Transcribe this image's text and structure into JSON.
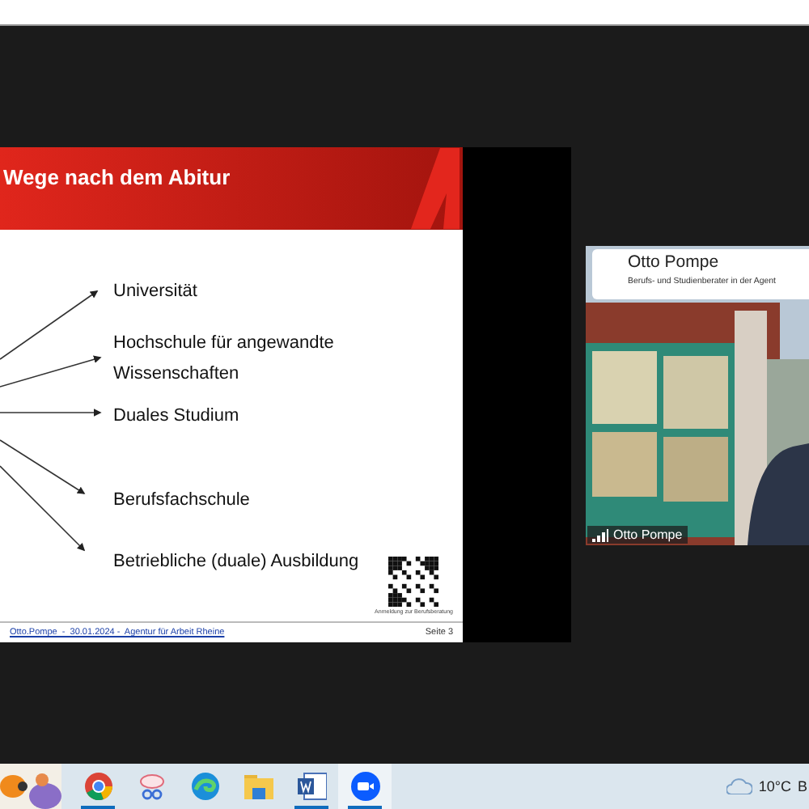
{
  "slide": {
    "title": "Wege nach dem Abitur",
    "options": [
      "Universität",
      "Hochschule für angewandte Wissenschaften",
      "Duales Studium",
      "Berufsfachschule",
      "Betriebliche (duale) Ausbildung"
    ],
    "qr_caption": "Anmeldung zur Berufsberatung",
    "footer_link": "Otto.Pompe  -  30.01.2024 -  Agentur für Arbeit Rheine",
    "page": "Seite 3"
  },
  "video": {
    "kind": "picture",
    "name": "Otto Pompe",
    "subtitle": "Berufs- und Studienberater in der Agent",
    "label": "Otto Pompe"
  },
  "taskbar": {
    "apps": [
      {
        "kind": "globe",
        "running": true,
        "selected": false
      },
      {
        "kind": "scissors",
        "running": false,
        "selected": false
      },
      {
        "kind": "wave",
        "running": false,
        "selected": false
      },
      {
        "kind": "folder",
        "running": false,
        "selected": false
      },
      {
        "kind": "document",
        "running": true,
        "selected": false
      },
      {
        "kind": "camera",
        "running": true,
        "selected": true
      }
    ],
    "temperature": "10°C",
    "weather_text": "B"
  }
}
